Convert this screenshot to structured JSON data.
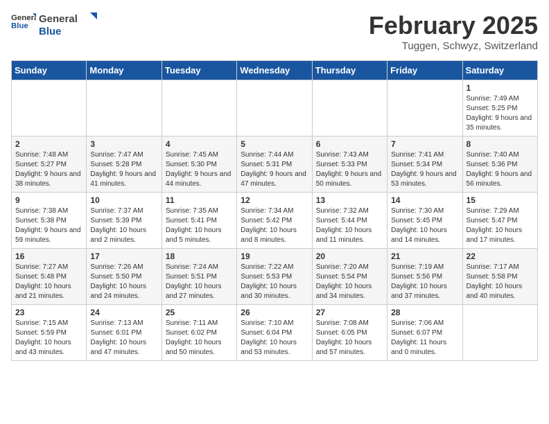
{
  "header": {
    "logo_general": "General",
    "logo_blue": "Blue",
    "month_title": "February 2025",
    "location": "Tuggen, Schwyz, Switzerland"
  },
  "days_of_week": [
    "Sunday",
    "Monday",
    "Tuesday",
    "Wednesday",
    "Thursday",
    "Friday",
    "Saturday"
  ],
  "weeks": [
    [
      {
        "day": "",
        "info": ""
      },
      {
        "day": "",
        "info": ""
      },
      {
        "day": "",
        "info": ""
      },
      {
        "day": "",
        "info": ""
      },
      {
        "day": "",
        "info": ""
      },
      {
        "day": "",
        "info": ""
      },
      {
        "day": "1",
        "info": "Sunrise: 7:49 AM\nSunset: 5:25 PM\nDaylight: 9 hours and 35 minutes."
      }
    ],
    [
      {
        "day": "2",
        "info": "Sunrise: 7:48 AM\nSunset: 5:27 PM\nDaylight: 9 hours and 38 minutes."
      },
      {
        "day": "3",
        "info": "Sunrise: 7:47 AM\nSunset: 5:28 PM\nDaylight: 9 hours and 41 minutes."
      },
      {
        "day": "4",
        "info": "Sunrise: 7:45 AM\nSunset: 5:30 PM\nDaylight: 9 hours and 44 minutes."
      },
      {
        "day": "5",
        "info": "Sunrise: 7:44 AM\nSunset: 5:31 PM\nDaylight: 9 hours and 47 minutes."
      },
      {
        "day": "6",
        "info": "Sunrise: 7:43 AM\nSunset: 5:33 PM\nDaylight: 9 hours and 50 minutes."
      },
      {
        "day": "7",
        "info": "Sunrise: 7:41 AM\nSunset: 5:34 PM\nDaylight: 9 hours and 53 minutes."
      },
      {
        "day": "8",
        "info": "Sunrise: 7:40 AM\nSunset: 5:36 PM\nDaylight: 9 hours and 56 minutes."
      }
    ],
    [
      {
        "day": "9",
        "info": "Sunrise: 7:38 AM\nSunset: 5:38 PM\nDaylight: 9 hours and 59 minutes."
      },
      {
        "day": "10",
        "info": "Sunrise: 7:37 AM\nSunset: 5:39 PM\nDaylight: 10 hours and 2 minutes."
      },
      {
        "day": "11",
        "info": "Sunrise: 7:35 AM\nSunset: 5:41 PM\nDaylight: 10 hours and 5 minutes."
      },
      {
        "day": "12",
        "info": "Sunrise: 7:34 AM\nSunset: 5:42 PM\nDaylight: 10 hours and 8 minutes."
      },
      {
        "day": "13",
        "info": "Sunrise: 7:32 AM\nSunset: 5:44 PM\nDaylight: 10 hours and 11 minutes."
      },
      {
        "day": "14",
        "info": "Sunrise: 7:30 AM\nSunset: 5:45 PM\nDaylight: 10 hours and 14 minutes."
      },
      {
        "day": "15",
        "info": "Sunrise: 7:29 AM\nSunset: 5:47 PM\nDaylight: 10 hours and 17 minutes."
      }
    ],
    [
      {
        "day": "16",
        "info": "Sunrise: 7:27 AM\nSunset: 5:48 PM\nDaylight: 10 hours and 21 minutes."
      },
      {
        "day": "17",
        "info": "Sunrise: 7:26 AM\nSunset: 5:50 PM\nDaylight: 10 hours and 24 minutes."
      },
      {
        "day": "18",
        "info": "Sunrise: 7:24 AM\nSunset: 5:51 PM\nDaylight: 10 hours and 27 minutes."
      },
      {
        "day": "19",
        "info": "Sunrise: 7:22 AM\nSunset: 5:53 PM\nDaylight: 10 hours and 30 minutes."
      },
      {
        "day": "20",
        "info": "Sunrise: 7:20 AM\nSunset: 5:54 PM\nDaylight: 10 hours and 34 minutes."
      },
      {
        "day": "21",
        "info": "Sunrise: 7:19 AM\nSunset: 5:56 PM\nDaylight: 10 hours and 37 minutes."
      },
      {
        "day": "22",
        "info": "Sunrise: 7:17 AM\nSunset: 5:58 PM\nDaylight: 10 hours and 40 minutes."
      }
    ],
    [
      {
        "day": "23",
        "info": "Sunrise: 7:15 AM\nSunset: 5:59 PM\nDaylight: 10 hours and 43 minutes."
      },
      {
        "day": "24",
        "info": "Sunrise: 7:13 AM\nSunset: 6:01 PM\nDaylight: 10 hours and 47 minutes."
      },
      {
        "day": "25",
        "info": "Sunrise: 7:11 AM\nSunset: 6:02 PM\nDaylight: 10 hours and 50 minutes."
      },
      {
        "day": "26",
        "info": "Sunrise: 7:10 AM\nSunset: 6:04 PM\nDaylight: 10 hours and 53 minutes."
      },
      {
        "day": "27",
        "info": "Sunrise: 7:08 AM\nSunset: 6:05 PM\nDaylight: 10 hours and 57 minutes."
      },
      {
        "day": "28",
        "info": "Sunrise: 7:06 AM\nSunset: 6:07 PM\nDaylight: 11 hours and 0 minutes."
      },
      {
        "day": "",
        "info": ""
      }
    ]
  ]
}
